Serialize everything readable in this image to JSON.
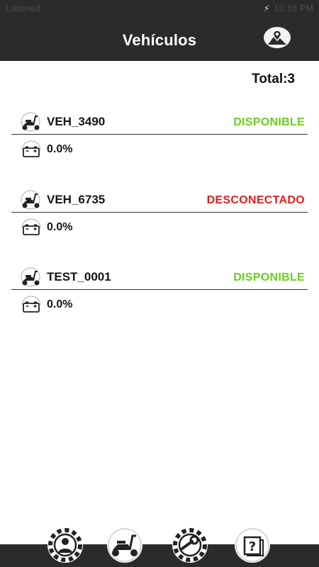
{
  "status_bar": {
    "carrier": "Listened",
    "time": "10:18 PM",
    "battery_indicator": "⚡"
  },
  "header": {
    "title": "Vehículos",
    "map_button_icon": "map-pin-mountains-icon"
  },
  "summary": {
    "total_label": "Total:3"
  },
  "vehicles": [
    {
      "name": "VEH_3490",
      "status": "DISPONIBLE",
      "status_color": "#6ccc1f",
      "battery": "0.0%"
    },
    {
      "name": "VEH_6735",
      "status": "DESCONECTADO",
      "status_color": "#e02020",
      "battery": "0.0%"
    },
    {
      "name": "TEST_0001",
      "status": "DISPONIBLE",
      "status_color": "#6ccc1f",
      "battery": "0.0%"
    }
  ],
  "bottom_nav": [
    {
      "icon": "user-gear-icon"
    },
    {
      "icon": "scooter-icon"
    },
    {
      "icon": "wrench-gear-icon"
    },
    {
      "icon": "help-question-icon"
    }
  ],
  "colors": {
    "bar_background": "#2b2b2b",
    "available": "#6ccc1f",
    "disconnected": "#e02020"
  }
}
